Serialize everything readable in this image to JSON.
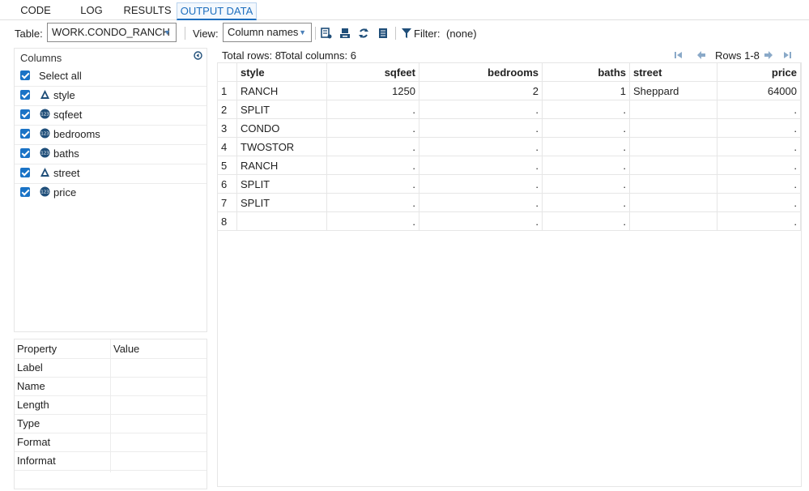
{
  "tabs": [
    "CODE",
    "LOG",
    "RESULTS",
    "OUTPUT DATA"
  ],
  "toolbar": {
    "table_label": "Table:",
    "table_value": "WORK.CONDO_RANCH",
    "view_label": "View:",
    "view_value": "Column names",
    "filter_label": "Filter:",
    "filter_value": "(none)"
  },
  "columns_panel": {
    "header": "Columns",
    "items": [
      {
        "label": "Select all",
        "type": "none"
      },
      {
        "label": "style",
        "type": "character"
      },
      {
        "label": "sqfeet",
        "type": "numeric"
      },
      {
        "label": "bedrooms",
        "type": "numeric"
      },
      {
        "label": "baths",
        "type": "numeric"
      },
      {
        "label": "street",
        "type": "character"
      },
      {
        "label": "price",
        "type": "numeric"
      }
    ]
  },
  "properties": {
    "headers": [
      "Property",
      "Value"
    ],
    "rows": [
      "Label",
      "Name",
      "Length",
      "Type",
      "Format",
      "Informat"
    ]
  },
  "summary": {
    "total_rows": "Total rows: 8",
    "total_columns": "Total columns: 6",
    "rows_range": "Rows 1-8"
  },
  "table": {
    "headers": [
      "",
      "style",
      "sqfeet",
      "bedrooms",
      "baths",
      "street",
      "price"
    ],
    "rows": [
      [
        "1",
        "RANCH",
        "1250",
        "2",
        "1",
        "Sheppard",
        "64000"
      ],
      [
        "2",
        "SPLIT",
        ".",
        ".",
        ".",
        "",
        "."
      ],
      [
        "3",
        "CONDO",
        ".",
        ".",
        ".",
        "",
        "."
      ],
      [
        "4",
        "TWOSTOR",
        ".",
        ".",
        ".",
        "",
        "."
      ],
      [
        "5",
        "RANCH",
        ".",
        ".",
        ".",
        "",
        "."
      ],
      [
        "6",
        "SPLIT",
        ".",
        ".",
        ".",
        "",
        "."
      ],
      [
        "7",
        "SPLIT",
        ".",
        ".",
        ".",
        "",
        "."
      ],
      [
        "8",
        "",
        ".",
        ".",
        ".",
        "",
        "."
      ]
    ]
  },
  "colors": {
    "accent": "#1e6fbf",
    "checkbox": "#1a73c6",
    "icon": "#1f4e79"
  }
}
